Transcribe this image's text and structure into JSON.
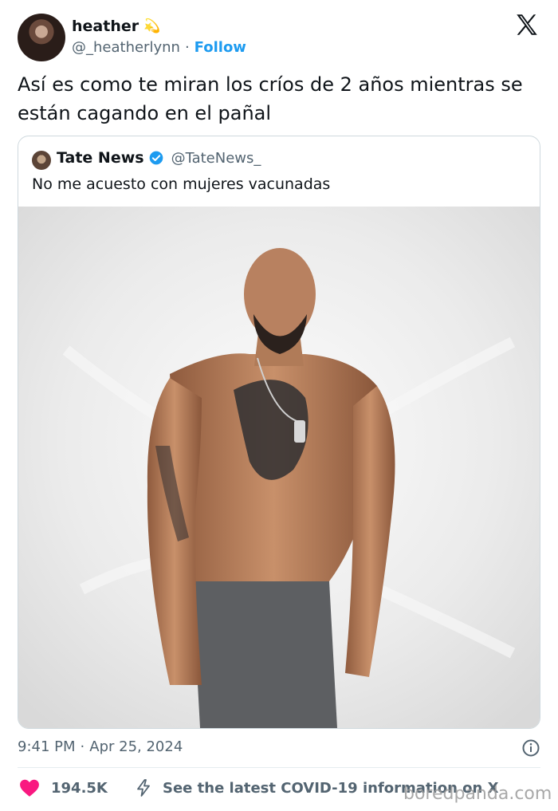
{
  "author": {
    "name": "heather",
    "handle": "@_heatherlynn",
    "separator": "·",
    "follow_label": "Follow",
    "star": "💫"
  },
  "tweet": {
    "text": "Así es como te miran los críos de 2 años mientras se están cagando en el pañal"
  },
  "quote": {
    "name": "Tate News",
    "handle": "@TateNews_",
    "text": "No me acuesto con mujeres vacunadas"
  },
  "meta": {
    "time": "9:41 PM",
    "separator": "·",
    "date": "Apr 25, 2024"
  },
  "actions": {
    "likes": "194.5K",
    "covid_label": "See the latest COVID-19 information on X"
  },
  "watermark": "boredpanda.com",
  "colors": {
    "link": "#1d9bf0",
    "heart": "#f91880",
    "muted": "#536471",
    "text": "#0f1419"
  }
}
